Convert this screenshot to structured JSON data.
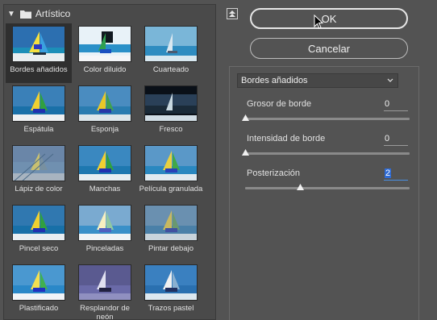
{
  "gallery": {
    "folder_label": "Artístico",
    "items": [
      {
        "label": "Bordes añadidos",
        "selected": true
      },
      {
        "label": "Color diluido"
      },
      {
        "label": "Cuarteado"
      },
      {
        "label": "Espátula"
      },
      {
        "label": "Esponja"
      },
      {
        "label": "Fresco"
      },
      {
        "label": "Lápiz de color"
      },
      {
        "label": "Manchas"
      },
      {
        "label": "Película granulada"
      },
      {
        "label": "Pincel seco"
      },
      {
        "label": "Pinceladas"
      },
      {
        "label": "Pintar debajo"
      },
      {
        "label": "Plastificado"
      },
      {
        "label": "Resplandor de neón"
      },
      {
        "label": "Trazos pastel"
      }
    ]
  },
  "buttons": {
    "ok": "OK",
    "cancel": "Cancelar"
  },
  "filter_select": {
    "value": "Bordes añadidos"
  },
  "params": [
    {
      "label": "Grosor de borde",
      "value": "0",
      "fraction": 0.0
    },
    {
      "label": "Intensidad de borde",
      "value": "0",
      "fraction": 0.0
    },
    {
      "label": "Posterización",
      "value": "2",
      "fraction": 0.33,
      "active": true
    }
  ],
  "colors": {
    "background": "#535353",
    "panel": "#4a4a4a",
    "selected_cell": "#2f2f2f",
    "accent": "#2e6bd6"
  },
  "icons": {
    "collapse": "collapse-up-icon",
    "folder": "folder-icon",
    "disclosure": "triangle-down-icon",
    "dropdown": "chevron-down-icon",
    "cursor": "mouse-pointer-icon"
  }
}
